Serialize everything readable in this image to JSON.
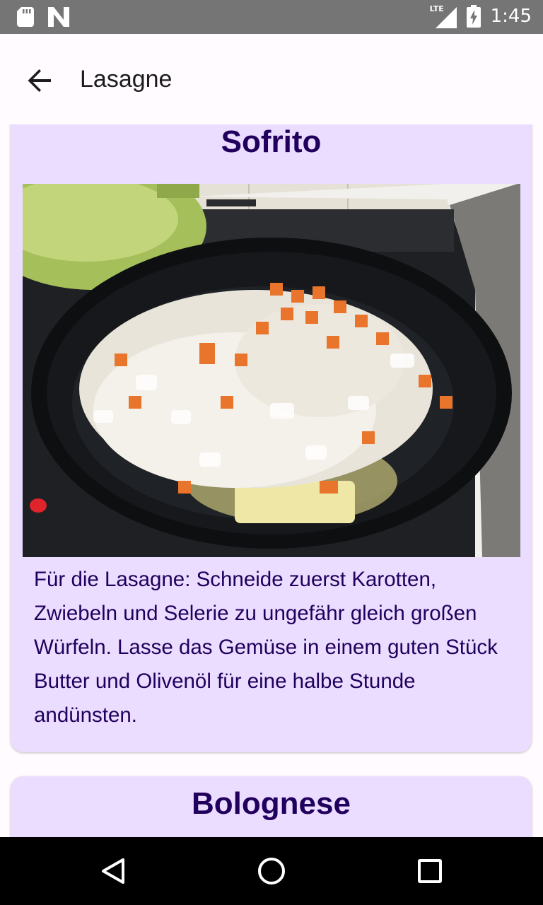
{
  "status_bar": {
    "time": "1:45",
    "network": "LTE",
    "icons": [
      "sd-card-icon",
      "n-notification-icon",
      "lte-signal-icon",
      "battery-charging-icon"
    ]
  },
  "app_bar": {
    "title": "Lasagne",
    "back_icon": "arrow-back-icon"
  },
  "steps": [
    {
      "title": "Sofrito",
      "image": "pan-with-diced-onions-and-carrots",
      "text": "Für die Lasagne: Schneide zuerst Karotten, Zwiebeln und Selerie zu ungefähr gleich großen Würfeln. Lasse das Gemüse in einem guten Stück Butter und Olivenöl für eine halbe Stunde andünsten."
    },
    {
      "title": "Bolognese"
    }
  ],
  "colors": {
    "card_background": "#EADDFF",
    "card_text": "#21005D",
    "status_bar": "#757575",
    "nav_bar": "#000000",
    "app_background": "#FFFBFE"
  },
  "nav_bar": {
    "buttons": [
      "back-triangle-icon",
      "home-circle-icon",
      "recents-square-icon"
    ]
  }
}
